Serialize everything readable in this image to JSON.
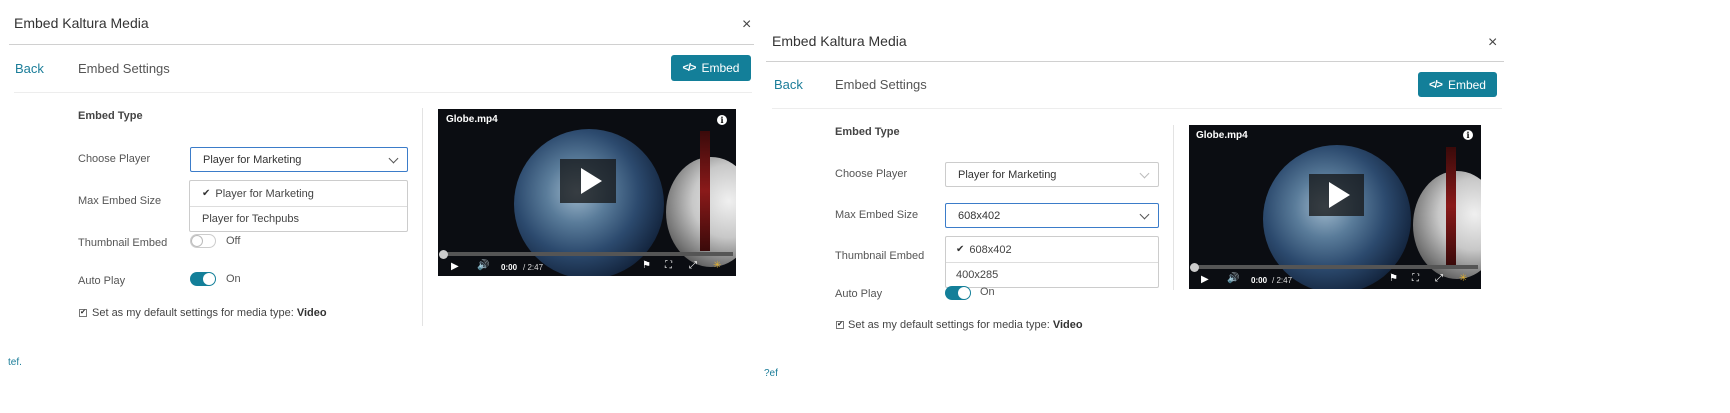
{
  "left": {
    "title": "Embed Kaltura Media",
    "close_glyph": "×",
    "back_label": "Back",
    "embed_settings_label": "Embed Settings",
    "embed_button_label": "Embed",
    "embed_button_icon": "code-icon",
    "embed_type_heading": "Embed Type",
    "choose_player_label": "Choose Player",
    "choose_player_value": "Player for Marketing",
    "choose_player_options": [
      "Player for Marketing",
      "Player for Techpubs"
    ],
    "choose_player_selected": "Player for Marketing",
    "max_embed_size_label": "Max Embed Size",
    "thumbnail_embed_label": "Thumbnail Embed",
    "thumbnail_embed_state": "Off",
    "auto_play_label": "Auto Play",
    "auto_play_state": "On",
    "default_settings_text": "Set as my default settings for media type:",
    "default_settings_type": "Video",
    "ref_fragment": "tef.",
    "player": {
      "clip_title": "Globe.mp4",
      "time_current": "0:00",
      "time_total": "/ 2:47",
      "progress_fraction": 0.0
    }
  },
  "right": {
    "title": "Embed Kaltura Media",
    "close_glyph": "×",
    "back_label": "Back",
    "embed_settings_label": "Embed Settings",
    "embed_button_label": "Embed",
    "embed_button_icon": "code-icon",
    "embed_type_heading": "Embed Type",
    "choose_player_label": "Choose Player",
    "choose_player_value": "Player for Marketing",
    "max_embed_size_label": "Max Embed Size",
    "max_embed_size_value": "608x402",
    "max_embed_size_options": [
      "608x402",
      "400x285"
    ],
    "max_embed_size_selected": "608x402",
    "thumbnail_embed_label": "Thumbnail Embed",
    "auto_play_label": "Auto Play",
    "auto_play_state": "On",
    "default_settings_text": "Set as my default settings for media type:",
    "default_settings_type": "Video",
    "ref_fragment": "?ef",
    "player": {
      "clip_title": "Globe.mp4",
      "time_current": "0:00",
      "time_total": "/ 2:47",
      "progress_fraction": 0.0
    }
  },
  "colors": {
    "accent": "#137f99",
    "link": "#1b7d99",
    "focus_border": "#3b7cc9"
  },
  "icons": [
    "close-icon",
    "code-icon",
    "chevron-down-icon",
    "check-icon",
    "info-icon",
    "play-icon",
    "volume-icon",
    "flag-icon",
    "fullscreen-icon",
    "expand-icon",
    "kaltura-logo-icon"
  ]
}
